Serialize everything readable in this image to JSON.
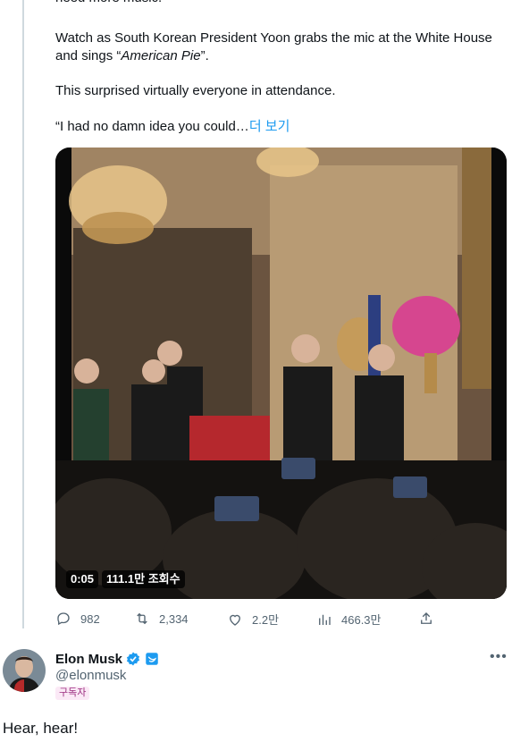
{
  "tweet": {
    "text_line0": "need more music.",
    "text_line1_prefix": "Watch as South Korean President Yoon grabs the mic at the White House and sings “",
    "text_line1_italic": "American Pie",
    "text_line1_suffix": "”.",
    "text_line2": "This surprised virtually everyone in attendance.",
    "text_line3": "“I had no damn idea you could…",
    "show_more": "더 보기",
    "video": {
      "timestamp": "0:05",
      "views_label": "111.1만 조회수"
    },
    "actions": {
      "replies": "982",
      "retweets": "2,334",
      "likes": "2.2만",
      "views": "466.3만"
    }
  },
  "reply": {
    "author_name": "Elon Musk",
    "handle": "@elonmusk",
    "subscriber_badge": "구독자",
    "text": "Hear, hear!",
    "more_icon": "more-dots-icon"
  },
  "colors": {
    "link": "#1d9bf0",
    "muted": "#536471",
    "verified": "#1d9bf0",
    "thread_line": "#cfd9de"
  }
}
